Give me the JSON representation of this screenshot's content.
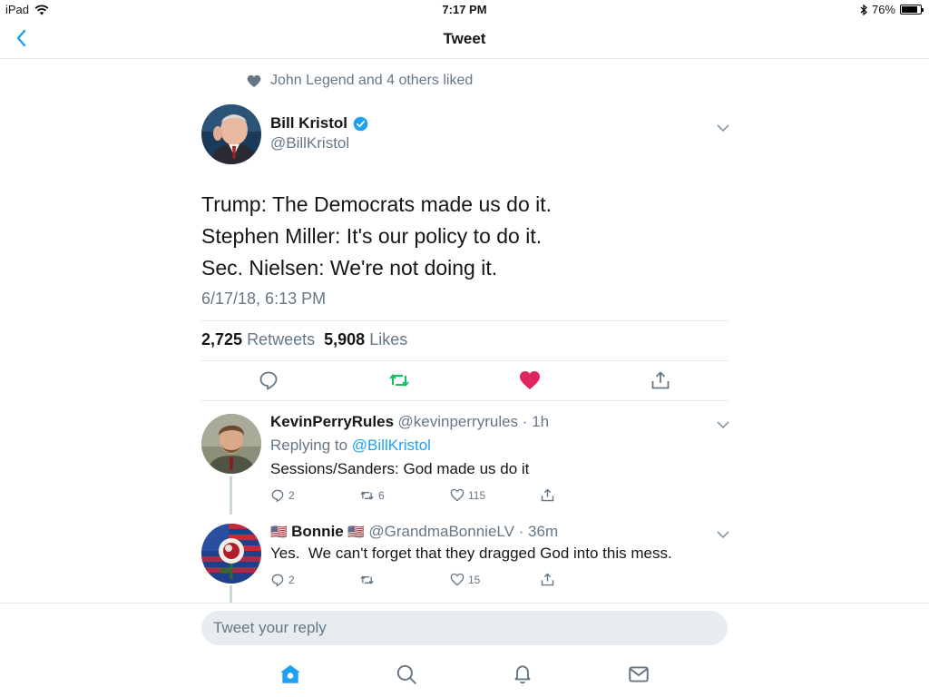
{
  "status_bar": {
    "device": "iPad",
    "time": "7:17 PM",
    "battery": "76%",
    "battery_level": 0.76
  },
  "nav": {
    "title": "Tweet"
  },
  "social_context": {
    "text": "John Legend and 4 others liked"
  },
  "tweet": {
    "author_name": "Bill Kristol",
    "handle": "@BillKristol",
    "lines": [
      "Trump: The Democrats made us do it.",
      "Stephen Miller: It's our policy to do it.",
      "Sec. Nielsen: We're not doing it."
    ],
    "timestamp": "6/17/18, 6:13 PM",
    "retweets": "2,725",
    "retweets_label": "Retweets",
    "likes": "5,908",
    "likes_label": "Likes"
  },
  "replies": [
    {
      "name": "KevinPerryRules",
      "meta": "@kevinperryrules · 1h",
      "replying_to_label": "Replying to",
      "replying_to_handle": "@BillKristol",
      "text": "Sessions/Sanders: God made us do it",
      "reply_count": "2",
      "retweet_count": "6",
      "like_count": "115"
    },
    {
      "name_flag_left": "🇺🇸",
      "name": "Bonnie",
      "name_flag_right": "🇺🇸",
      "meta": "@GrandmaBonnieLV · 36m",
      "text": "Yes.  We can't forget that they dragged God into this mess.",
      "reply_count": "2",
      "like_count": "15"
    }
  ],
  "composer": {
    "placeholder": "Tweet your reply"
  },
  "colors": {
    "accent": "#1da1f2",
    "retweet": "#17bf63",
    "like": "#e0245e",
    "muted": "#657786"
  }
}
